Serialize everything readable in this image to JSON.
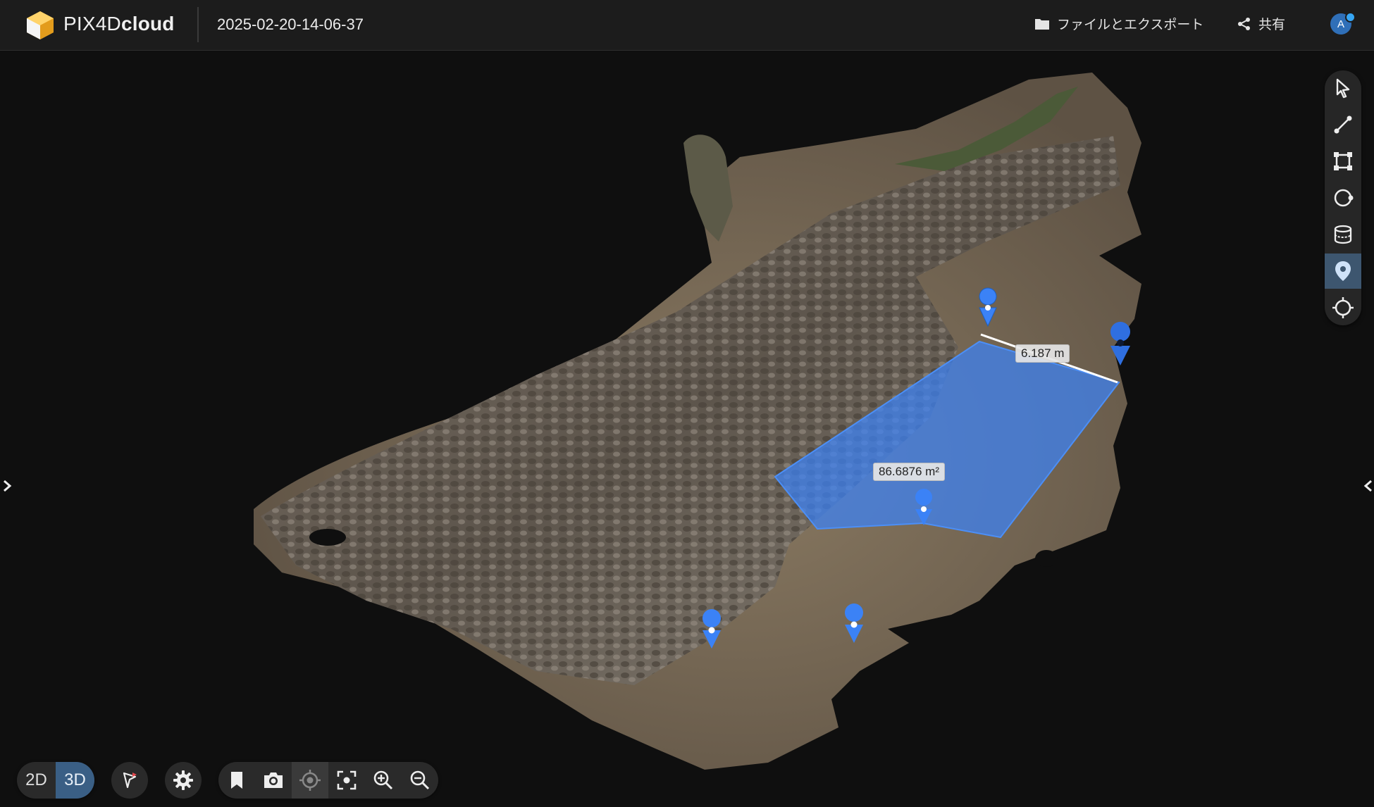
{
  "header": {
    "brand_light": "PIX4D",
    "brand_bold": "cloud",
    "project_name": "2025-02-20-14-06-37",
    "files_label": "ファイルとエクスポート",
    "share_label": "共有",
    "avatar_initial": "A"
  },
  "measurements": {
    "distance_label": "6.187 m",
    "area_label": "86.6876 m²"
  },
  "right_toolbar": {
    "tools": [
      "select-icon",
      "polyline-icon",
      "polygon-icon",
      "circle-tool-icon",
      "volume-icon",
      "marker-icon",
      "crosshair-icon"
    ],
    "active_tool": "marker-icon"
  },
  "view_toggle": {
    "label_2d": "2D",
    "label_3d": "3D",
    "active": "3D"
  },
  "colors": {
    "accent": "#3a5f85",
    "measure_blue": "#3b82f6",
    "header_bg": "#1c1c1c"
  }
}
